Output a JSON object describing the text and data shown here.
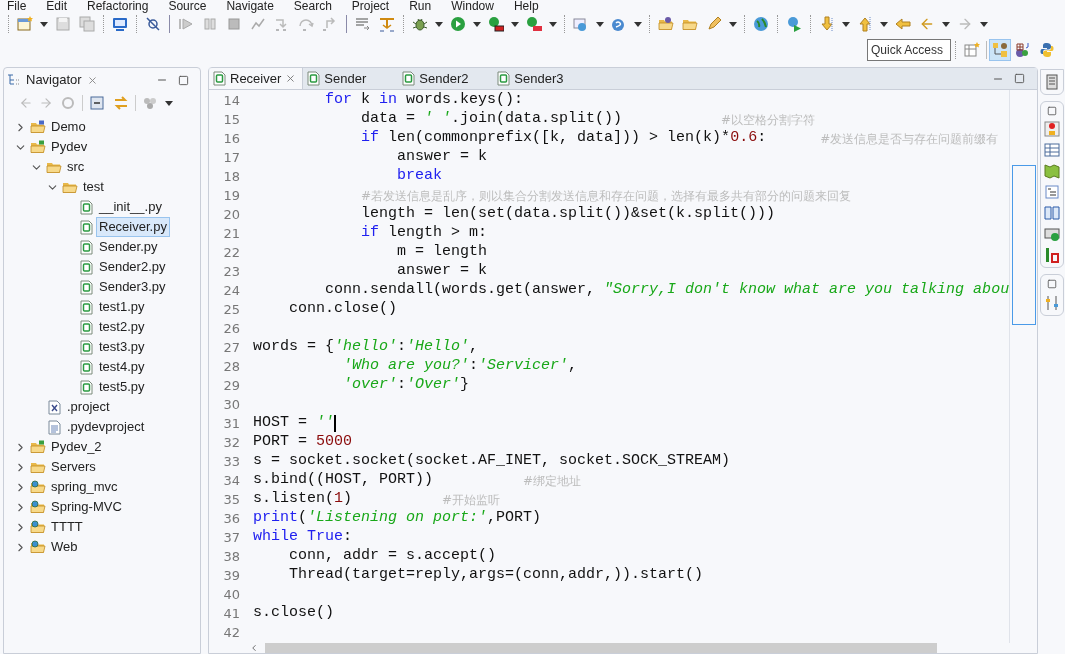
{
  "menu": [
    "File",
    "Edit",
    "Refactoring",
    "Source",
    "Navigate",
    "Search",
    "Project",
    "Run",
    "Window",
    "Help"
  ],
  "quick_access": {
    "placeholder": "Quick Access"
  },
  "navigator": {
    "title": "Navigator",
    "tree": [
      {
        "label": "Demo",
        "kind": "project-java",
        "expanded": false,
        "selected": false
      },
      {
        "label": "Pydev",
        "kind": "project-py",
        "expanded": true,
        "selected": false,
        "children": [
          {
            "label": "src",
            "kind": "folder",
            "expanded": true,
            "selected": false,
            "children": [
              {
                "label": "test",
                "kind": "folder",
                "expanded": true,
                "selected": false,
                "children": [
                  {
                    "label": "__init__.py",
                    "kind": "pyfile",
                    "selected": false
                  },
                  {
                    "label": "Receiver.py",
                    "kind": "pyfile",
                    "selected": true
                  },
                  {
                    "label": "Sender.py",
                    "kind": "pyfile",
                    "selected": false
                  },
                  {
                    "label": "Sender2.py",
                    "kind": "pyfile",
                    "selected": false
                  },
                  {
                    "label": "Sender3.py",
                    "kind": "pyfile",
                    "selected": false
                  },
                  {
                    "label": "test1.py",
                    "kind": "pyfile",
                    "selected": false
                  },
                  {
                    "label": "test2.py",
                    "kind": "pyfile",
                    "selected": false
                  },
                  {
                    "label": "test3.py",
                    "kind": "pyfile",
                    "selected": false
                  },
                  {
                    "label": "test4.py",
                    "kind": "pyfile",
                    "selected": false
                  },
                  {
                    "label": "test5.py",
                    "kind": "pyfile",
                    "selected": false
                  }
                ]
              }
            ]
          },
          {
            "label": ".project",
            "kind": "xmlfile",
            "selected": false
          },
          {
            "label": ".pydevproject",
            "kind": "textfile",
            "selected": false
          }
        ]
      },
      {
        "label": "Pydev_2",
        "kind": "project-py",
        "expanded": false,
        "selected": false
      },
      {
        "label": "Servers",
        "kind": "folder",
        "expanded": false,
        "selected": false
      },
      {
        "label": "spring_mvc",
        "kind": "project-web",
        "expanded": false,
        "selected": false
      },
      {
        "label": "Spring-MVC",
        "kind": "project-web",
        "expanded": false,
        "selected": false
      },
      {
        "label": "TTTT",
        "kind": "project-web",
        "expanded": false,
        "selected": false
      },
      {
        "label": "Web",
        "kind": "project-web",
        "expanded": false,
        "selected": false
      }
    ]
  },
  "editor": {
    "tabs": [
      {
        "label": "Receiver",
        "selected": true
      },
      {
        "label": "Sender",
        "selected": false
      },
      {
        "label": "Sender2",
        "selected": false
      },
      {
        "label": "Sender3",
        "selected": false
      }
    ],
    "lines": [
      {
        "number": "14",
        "tokens": [
          {
            "kind": "kw",
            "text": "        for"
          },
          {
            "kind": "plain",
            "text": " k "
          },
          {
            "kind": "kw",
            "text": "in"
          },
          {
            "kind": "plain",
            "text": " words.keys():"
          }
        ]
      },
      {
        "number": "15",
        "tokens": [
          {
            "kind": "plain",
            "text": "            data = "
          },
          {
            "kind": "str",
            "text": "' '"
          },
          {
            "kind": "plain",
            "text": ".join(data.split())           "
          },
          {
            "kind": "comment",
            "text": "#以空格分割字符"
          }
        ]
      },
      {
        "number": "16",
        "tokens": [
          {
            "kind": "kw",
            "text": "            if"
          },
          {
            "kind": "plain",
            "text": " len(commonprefix([k, data])) > len(k)*"
          },
          {
            "kind": "num",
            "text": "0.6"
          },
          {
            "kind": "plain",
            "text": ":      "
          },
          {
            "kind": "comment",
            "text": "#发送信息是否与存在问题前缀有"
          }
        ]
      },
      {
        "number": "17",
        "tokens": [
          {
            "kind": "plain",
            "text": "                answer = k"
          }
        ]
      },
      {
        "number": "18",
        "tokens": [
          {
            "kind": "kw",
            "text": "                break"
          }
        ]
      },
      {
        "number": "19",
        "tokens": [
          {
            "kind": "comment",
            "text": "            #若发送信息是乱序，则以集合分割发送信息和存在问题，选择有最多共有部分的问题来回复"
          }
        ]
      },
      {
        "number": "20",
        "tokens": [
          {
            "kind": "plain",
            "text": "            length = len(set(data.split())&set(k.split()))"
          }
        ]
      },
      {
        "number": "21",
        "tokens": [
          {
            "kind": "kw",
            "text": "            if"
          },
          {
            "kind": "plain",
            "text": " length > m:"
          }
        ]
      },
      {
        "number": "22",
        "tokens": [
          {
            "kind": "plain",
            "text": "                m = length"
          }
        ]
      },
      {
        "number": "23",
        "tokens": [
          {
            "kind": "plain",
            "text": "                answer = k"
          }
        ]
      },
      {
        "number": "24",
        "tokens": [
          {
            "kind": "plain",
            "text": "        conn.sendall(words.get(answer, "
          },
          {
            "kind": "str",
            "text": "\"Sorry,I don't know what are you talking abou"
          }
        ]
      },
      {
        "number": "25",
        "tokens": [
          {
            "kind": "plain",
            "text": "    conn.close()"
          }
        ]
      },
      {
        "number": "26"
      },
      {
        "number": "27",
        "tokens": [
          {
            "kind": "plain",
            "text": "words = {"
          },
          {
            "kind": "str",
            "text": "'hello'"
          },
          {
            "kind": "plain",
            "text": ":"
          },
          {
            "kind": "str",
            "text": "'Hello'"
          },
          {
            "kind": "plain",
            "text": ","
          }
        ]
      },
      {
        "number": "28",
        "tokens": [
          {
            "kind": "str",
            "text": "          'Who are you?'"
          },
          {
            "kind": "plain",
            "text": ":"
          },
          {
            "kind": "str",
            "text": "'Servicer'"
          },
          {
            "kind": "plain",
            "text": ","
          }
        ]
      },
      {
        "number": "29",
        "tokens": [
          {
            "kind": "str",
            "text": "          'over'"
          },
          {
            "kind": "plain",
            "text": ":"
          },
          {
            "kind": "str",
            "text": "'Over'"
          },
          {
            "kind": "plain",
            "text": "}"
          }
        ]
      },
      {
        "number": "30"
      },
      {
        "number": "31",
        "cursor": true,
        "tokens": [
          {
            "kind": "plain",
            "text": "HOST = "
          },
          {
            "kind": "str",
            "text": "''"
          }
        ]
      },
      {
        "number": "32",
        "tokens": [
          {
            "kind": "plain",
            "text": "PORT = "
          },
          {
            "kind": "num",
            "text": "5000"
          }
        ]
      },
      {
        "number": "33",
        "tokens": [
          {
            "kind": "plain",
            "text": "s = socket.socket(socket.AF_INET, socket.SOCK_STREAM)"
          }
        ]
      },
      {
        "number": "34",
        "tokens": [
          {
            "kind": "plain",
            "text": "s.bind((HOST, PORT))          "
          },
          {
            "kind": "comment",
            "text": "#绑定地址"
          }
        ]
      },
      {
        "number": "35",
        "tokens": [
          {
            "kind": "plain",
            "text": "s.listen("
          },
          {
            "kind": "num",
            "text": "1"
          },
          {
            "kind": "plain",
            "text": ")          "
          },
          {
            "kind": "comment",
            "text": "#开始监听"
          }
        ]
      },
      {
        "number": "36",
        "tokens": [
          {
            "kind": "kw",
            "text": "print"
          },
          {
            "kind": "plain",
            "text": "("
          },
          {
            "kind": "str",
            "text": "'Listening on port:'"
          },
          {
            "kind": "plain",
            "text": ",PORT)"
          }
        ]
      },
      {
        "number": "37",
        "tokens": [
          {
            "kind": "kw",
            "text": "while True"
          },
          {
            "kind": "plain",
            "text": ":"
          }
        ]
      },
      {
        "number": "38",
        "tokens": [
          {
            "kind": "plain",
            "text": "    conn, addr = s.accept()"
          }
        ]
      },
      {
        "number": "39",
        "tokens": [
          {
            "kind": "plain",
            "text": "    Thread(target=reply,args=(conn,addr,)).start()"
          }
        ]
      },
      {
        "number": "40"
      },
      {
        "number": "41",
        "tokens": [
          {
            "kind": "plain",
            "text": "s.close()"
          }
        ]
      },
      {
        "number": "42"
      }
    ]
  }
}
